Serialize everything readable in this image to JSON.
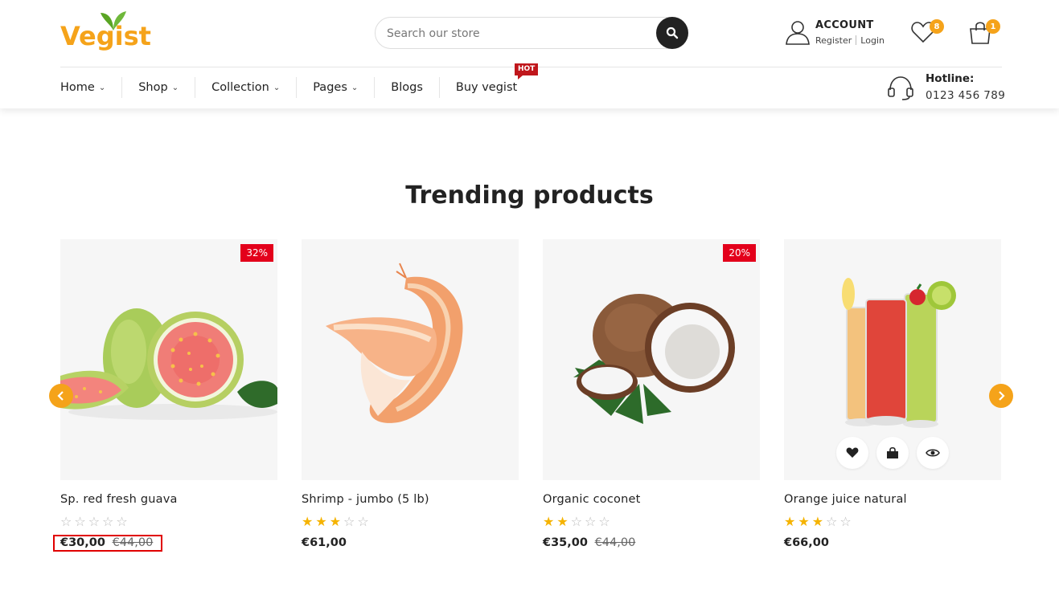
{
  "brand": {
    "logo_text": "Vegist",
    "accent_color": "#f5a31a",
    "leaf_color": "#5aa524"
  },
  "search": {
    "placeholder": "Search our store",
    "button_icon": "search-icon"
  },
  "account": {
    "title": "ACCOUNT",
    "register": "Register",
    "login": "Login"
  },
  "wishlist": {
    "count": "8",
    "icon": "heart-icon"
  },
  "cart": {
    "count": "1",
    "icon": "bag-icon"
  },
  "nav": {
    "items": [
      {
        "label": "Home",
        "has_dropdown": true
      },
      {
        "label": "Shop",
        "has_dropdown": true
      },
      {
        "label": "Collection",
        "has_dropdown": true
      },
      {
        "label": "Pages",
        "has_dropdown": true
      },
      {
        "label": "Blogs",
        "has_dropdown": false
      },
      {
        "label": "Buy vegist",
        "has_dropdown": false
      }
    ],
    "hot_badge": "HOT"
  },
  "hotline": {
    "title": "Hotline:",
    "number": "0123 456 789"
  },
  "section": {
    "title": "Trending products"
  },
  "products": [
    {
      "name": "Sp. red fresh guava",
      "discount": "32%",
      "rating": 0,
      "price": "€30,00",
      "old_price": "€44,00",
      "image": "guava"
    },
    {
      "name": "Shrimp - jumbo (5 lb)",
      "discount": "",
      "rating": 3,
      "price": "€61,00",
      "old_price": "",
      "image": "shrimp"
    },
    {
      "name": "Organic coconet",
      "discount": "20%",
      "rating": 2,
      "price": "€35,00",
      "old_price": "€44,00",
      "image": "coconut"
    },
    {
      "name": "Orange juice natural",
      "discount": "",
      "rating": 3,
      "price": "€66,00",
      "old_price": "",
      "image": "juice"
    }
  ],
  "card_actions": [
    "heart-icon",
    "bag-icon",
    "eye-icon"
  ],
  "colors": {
    "discount": "#e3001b",
    "star": "#f5b300",
    "highlight": "#e00000"
  }
}
